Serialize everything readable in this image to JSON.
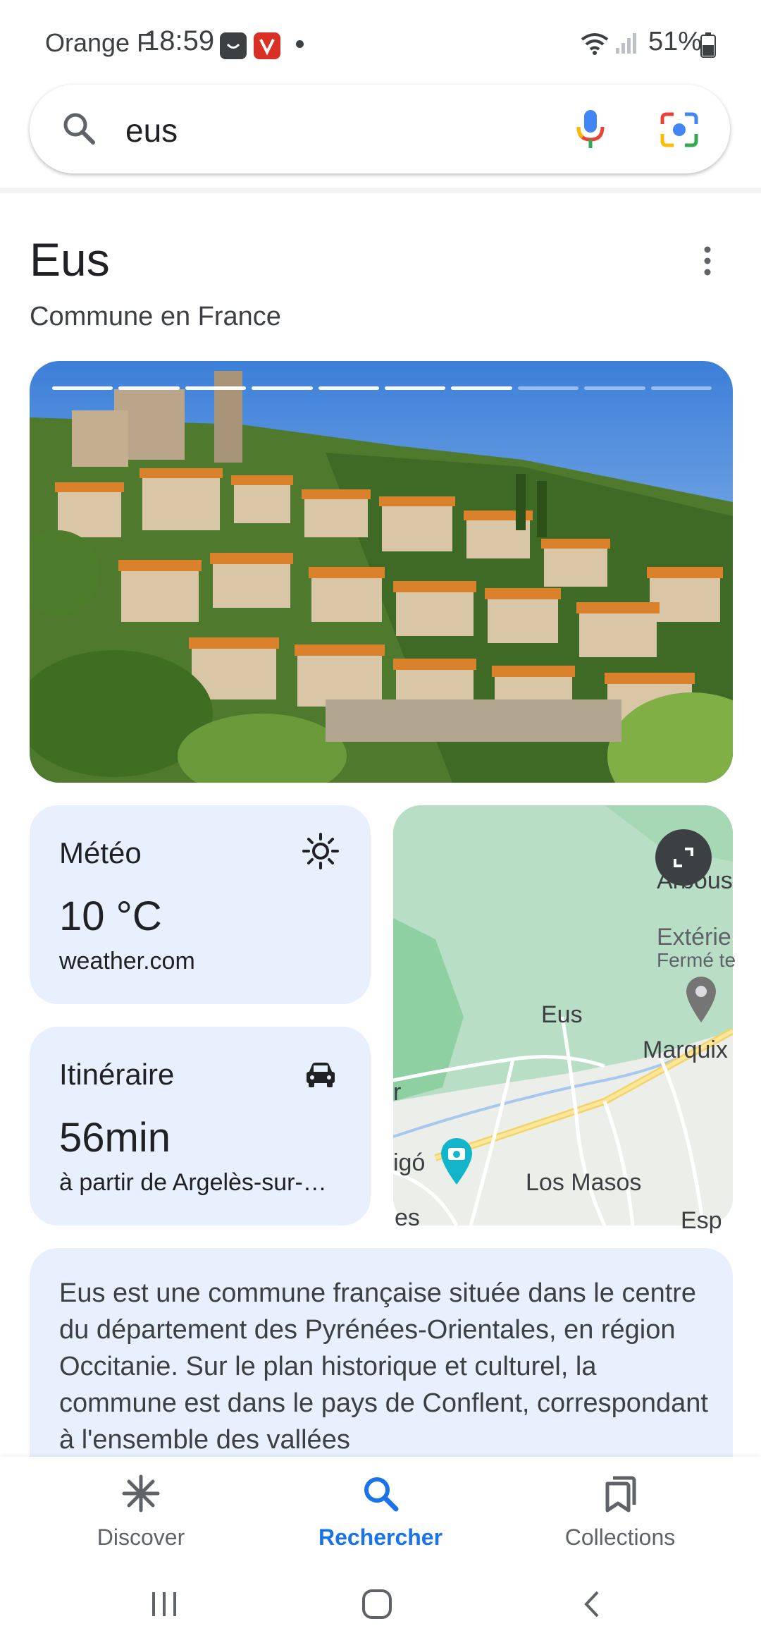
{
  "status_bar": {
    "carrier": "Orange F",
    "time": "18:59",
    "battery": "51%"
  },
  "search": {
    "query": "eus"
  },
  "entity": {
    "title": "Eus",
    "subtitle": "Commune en France"
  },
  "photo_carousel": {
    "segments_total": 10,
    "segments_seen": 7
  },
  "weather": {
    "label": "Météo",
    "temperature": "10 °C",
    "source": "weather.com"
  },
  "route": {
    "label": "Itinéraire",
    "duration": "56min",
    "origin": "à partir de Argelès-sur-…"
  },
  "map": {
    "labels": {
      "eus": "Eus",
      "los_masos": "Los Masos",
      "marquixanes": "Marquix",
      "arboussols": "Arbous",
      "exterieur": "Extérie",
      "ferme": "Fermé te",
      "prades_partial": "igó",
      "left_partial": "r",
      "bottom_left_partial": "es",
      "bottom_right_partial": "Esp"
    }
  },
  "description": {
    "text": "Eus est une commune française située dans le centre du département des Pyrénées-Orientales, en région Occitanie. Sur le plan historique et culturel, la commune est dans le pays de Conflent, correspondant à l'ensemble des vallées"
  },
  "bottom_nav": {
    "items": [
      {
        "label": "Discover",
        "icon": "asterisk-icon"
      },
      {
        "label": "Rechercher",
        "icon": "search-icon"
      },
      {
        "label": "Collections",
        "icon": "collections-icon"
      }
    ]
  },
  "colors": {
    "accent": "#1a73e8",
    "card_bg": "#e8f0fe",
    "text": "#202124"
  }
}
